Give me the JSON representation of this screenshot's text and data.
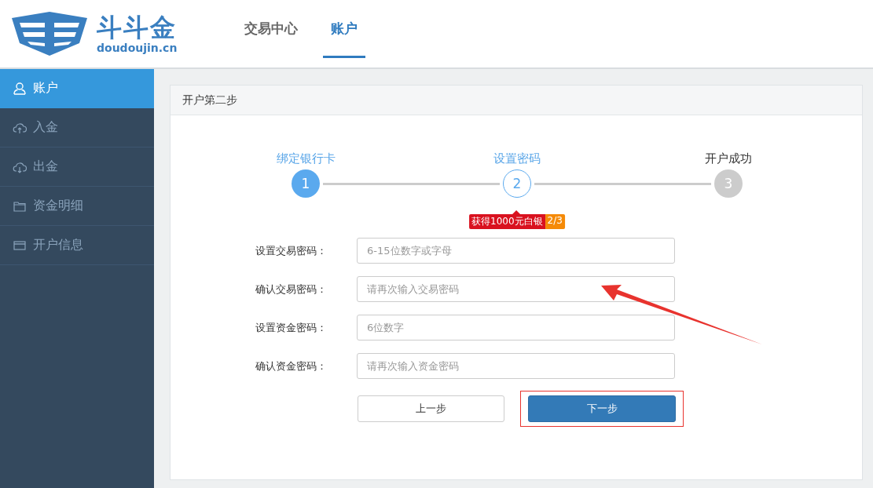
{
  "logo": {
    "name": "斗斗金",
    "domain": "doudoujin.cn"
  },
  "nav": [
    {
      "label": "交易中心",
      "selected": false
    },
    {
      "label": "账户",
      "selected": true
    }
  ],
  "sidebar": {
    "items": [
      {
        "label": "账户",
        "kind": "user",
        "selected": true
      },
      {
        "label": "入金",
        "kind": "upload",
        "selected": false
      },
      {
        "label": "出金",
        "kind": "download",
        "selected": false
      },
      {
        "label": "资金明细",
        "kind": "folder",
        "selected": false
      },
      {
        "label": "开户信息",
        "kind": "card",
        "selected": false
      }
    ]
  },
  "panel": {
    "title": "开户第二步",
    "steps": [
      {
        "label": "绑定银行卡",
        "number": "1",
        "kind": "done"
      },
      {
        "label": "设置密码",
        "number": "2",
        "kind": "current",
        "badge": {
          "text": "获得1000元白银",
          "count": "2/3"
        }
      },
      {
        "label": "开户成功",
        "number": "3",
        "kind": "pending"
      }
    ],
    "fields": [
      {
        "label": "设置交易密码：",
        "placeholder": "6-15位数字或字母"
      },
      {
        "label": "确认交易密码：",
        "placeholder": "请再次输入交易密码"
      },
      {
        "label": "设置资金密码：",
        "placeholder": "6位数字"
      },
      {
        "label": "确认资金密码：",
        "placeholder": "请再次输入资金密码"
      }
    ],
    "buttons": [
      {
        "label": "上一步",
        "kind": "secondary"
      },
      {
        "label": "下一步",
        "kind": "primary"
      }
    ]
  }
}
